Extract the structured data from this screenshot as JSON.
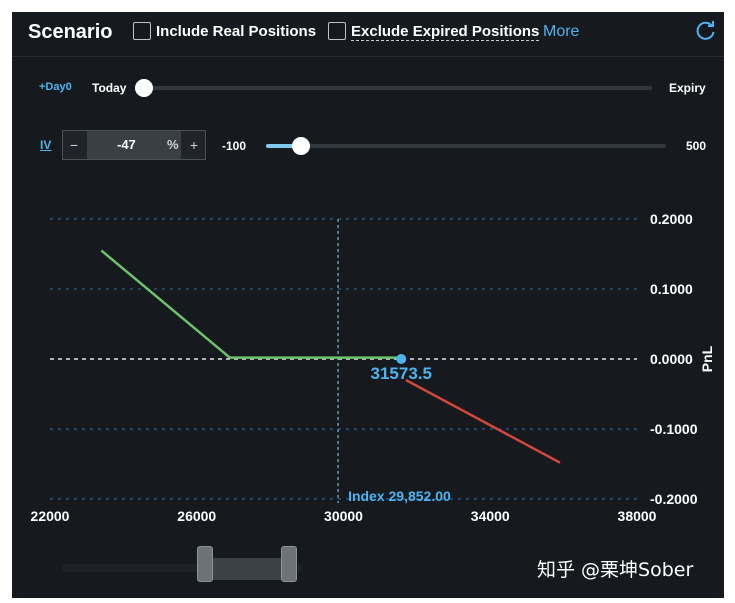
{
  "header": {
    "title": "Scenario",
    "include_real_label": "Include Real Positions",
    "include_real_checked": false,
    "exclude_expired_label": "Exclude Expired Positions",
    "exclude_expired_checked": false,
    "more_label": "More",
    "refresh_icon": "refresh-icon"
  },
  "day_slider": {
    "tag": "+Day0",
    "value_label": "Today",
    "end_label": "Expiry",
    "position": 0
  },
  "iv": {
    "label": "IV",
    "minus": "−",
    "value": "-47",
    "unit": "%",
    "plus": "+",
    "min_label": "-100",
    "max_label": "500",
    "value_num": -47,
    "min": -100,
    "max": 500
  },
  "chart_data": {
    "type": "line",
    "ylabel": "PnL",
    "xlim": [
      22000,
      38000
    ],
    "ylim": [
      -0.2,
      0.2
    ],
    "x_ticks": [
      "22000",
      "26000",
      "30000",
      "34000",
      "38000"
    ],
    "x_tick_values": [
      22000,
      26000,
      30000,
      34000,
      38000
    ],
    "y_ticks": [
      "0.2000",
      "0.1000",
      "0.0000",
      "-0.1000",
      "-0.2000"
    ],
    "y_tick_values": [
      0.2,
      0.1,
      0.0,
      -0.1,
      -0.2
    ],
    "series": [
      {
        "color": "#6cc26c",
        "points": [
          [
            23400,
            0.155
          ],
          [
            26900,
            0.002
          ],
          [
            31500,
            0.002
          ]
        ]
      },
      {
        "color": "#d0473c",
        "points": [
          [
            31700,
            -0.03
          ],
          [
            35900,
            -0.148
          ]
        ]
      }
    ],
    "breakeven": {
      "x": 31573.5,
      "y": 0.0,
      "label": "31573.5"
    },
    "index_line": {
      "x": 29852,
      "label": "Index 29,852.00"
    }
  },
  "watermark": "知乎 @栗坤Sober"
}
